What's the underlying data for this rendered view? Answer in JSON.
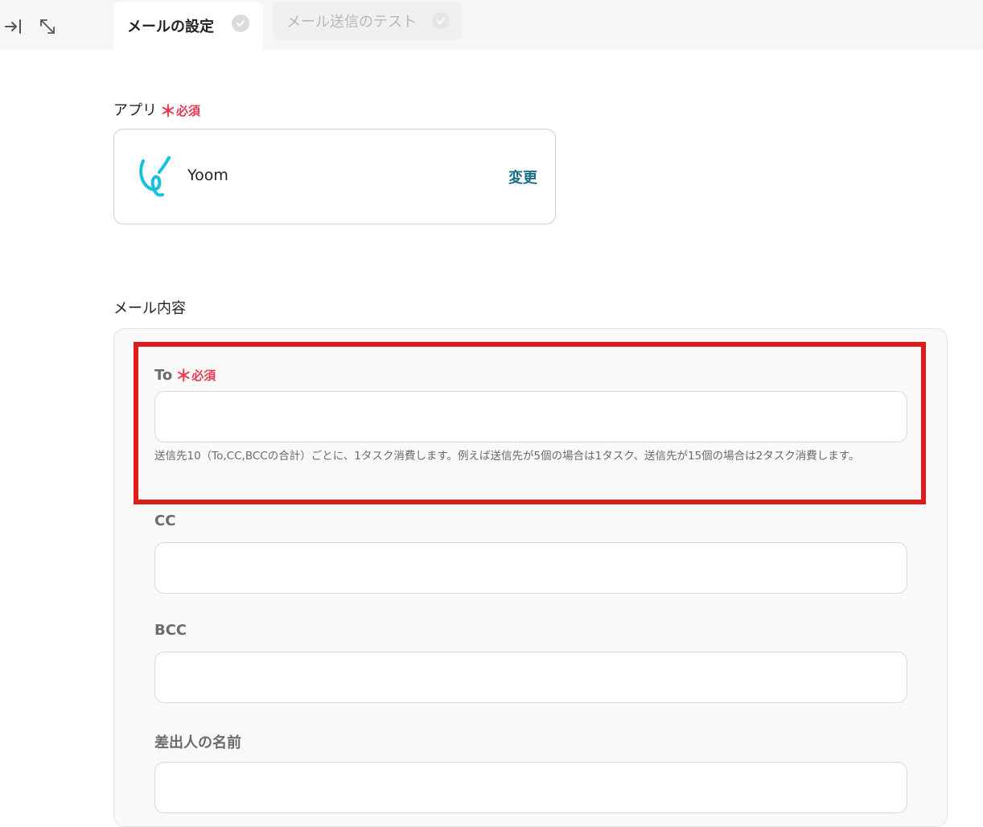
{
  "toolbar": {
    "collapse_icon": "arrow-right-to-bar-icon",
    "expand_icon": "diagonal-resize-icon"
  },
  "tabs": [
    {
      "label": "メールの設定",
      "active": true
    },
    {
      "label": "メール送信のテスト",
      "active": false
    }
  ],
  "app_section": {
    "label": "アプリ",
    "required_star": "＊",
    "required_text": "必須",
    "app_name": "Yoom",
    "change_label": "変更"
  },
  "mail_section": {
    "label": "メール内容",
    "to": {
      "label": "To",
      "required_star": "＊",
      "required_text": "必須",
      "value": "",
      "help": "送信先10（To,CC,BCCの合計）ごとに、1タスク消費します。例えば送信先が5個の場合は1タスク、送信先が15個の場合は2タスク消費します。"
    },
    "cc": {
      "label": "CC",
      "value": ""
    },
    "bcc": {
      "label": "BCC",
      "value": ""
    },
    "sender_name": {
      "label": "差出人の名前",
      "value": ""
    }
  },
  "colors": {
    "required": "#e53950",
    "link": "#1b6f8a",
    "highlight": "#e01b1b",
    "logo": "#18c1d9"
  }
}
